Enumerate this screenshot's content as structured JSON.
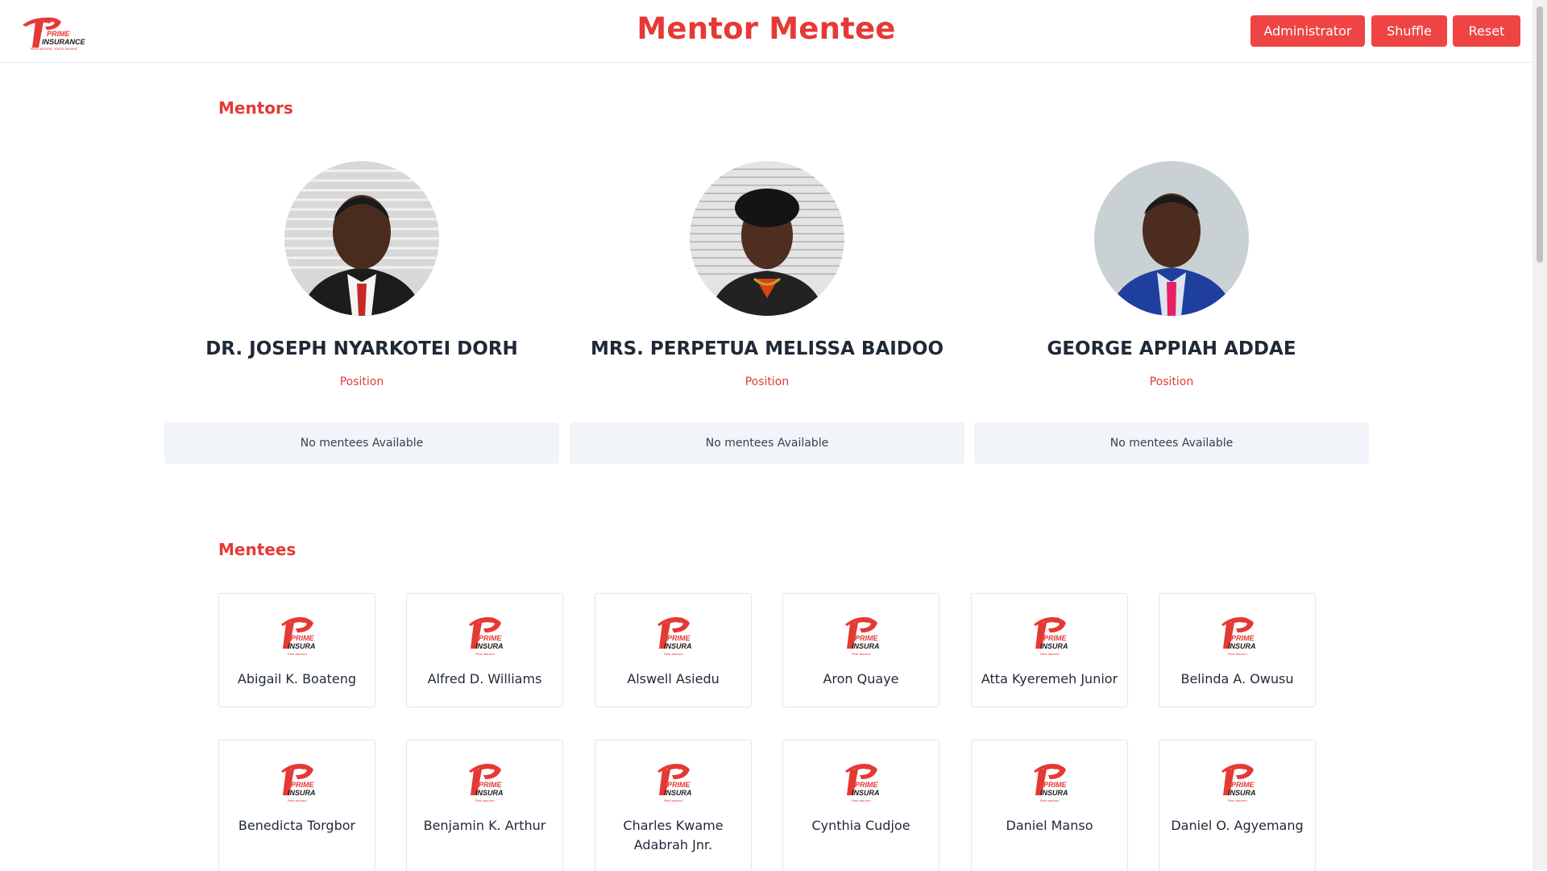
{
  "header": {
    "title": "Mentor Mentee",
    "logo_text": "PRIME INSURANCE",
    "logo_tagline": "Rest assured. You're insured",
    "buttons": {
      "administrator": "Administrator",
      "shuffle": "Shuffle",
      "reset": "Reset"
    }
  },
  "colors": {
    "accent": "#e53935",
    "button": "#ef4444",
    "panel": "#f1f4f8"
  },
  "mentors_section": {
    "heading": "Mentors",
    "mentors": [
      {
        "name": "DR. JOSEPH NYARKOTEI DORH",
        "position": "Position",
        "mentees_text": "No mentees Available"
      },
      {
        "name": "MRS. PERPETUA MELISSA BAIDOO",
        "position": "Position",
        "mentees_text": "No mentees Available"
      },
      {
        "name": "GEORGE APPIAH ADDAE",
        "position": "Position",
        "mentees_text": "No mentees Available"
      }
    ]
  },
  "mentees_section": {
    "heading": "Mentees",
    "mentees": [
      "Abigail K. Boateng",
      "Alfred D. Williams",
      "Alswell Asiedu",
      "Aron Quaye",
      "Atta Kyeremeh Junior",
      "Belinda A. Owusu",
      "Benedicta Torgbor",
      "Benjamin K. Arthur",
      "Charles Kwame Adabrah Jnr.",
      "Cynthia Cudjoe",
      "Daniel Manso",
      "Daniel O. Agyemang"
    ]
  }
}
